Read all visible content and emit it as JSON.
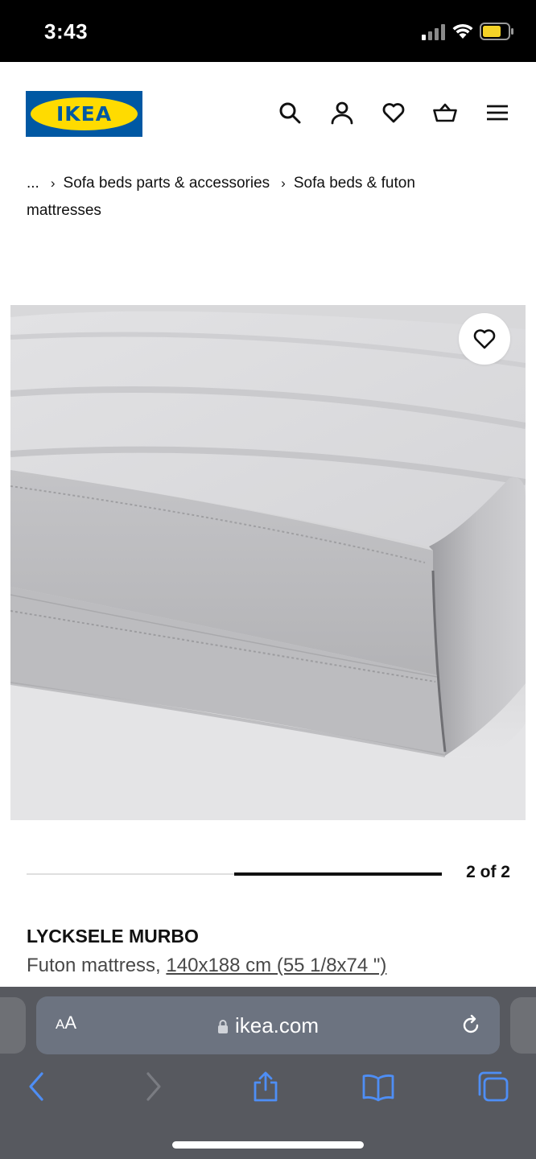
{
  "status_bar": {
    "time": "3:43"
  },
  "header": {
    "logo_text": "IKEA",
    "icons": [
      "search-icon",
      "account-icon",
      "favorites-icon",
      "cart-icon",
      "menu-icon"
    ]
  },
  "breadcrumb": {
    "ellipsis": "...",
    "items": [
      "Sofa beds parts & accessories",
      "Sofa beds & futon",
      "mattresses"
    ]
  },
  "carousel": {
    "counter": "2 of 2",
    "current": 2,
    "total": 2
  },
  "product": {
    "name": "LYCKSELE MURBO",
    "type": "Futon mattress,",
    "size": "140x188 cm (55 1/8x74 \")"
  },
  "browser": {
    "aa_large": "A",
    "aa_small": "A",
    "url": "ikea.com"
  },
  "colors": {
    "ikea_blue": "#0058a3",
    "ikea_yellow": "#ffdb00",
    "browser_bar": "#57595f",
    "address_bar": "#6c7380",
    "toolbar_blue": "#4e8ef5"
  }
}
